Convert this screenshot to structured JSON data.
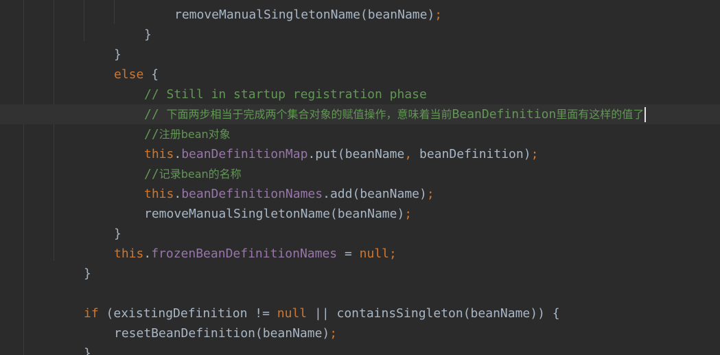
{
  "editor": {
    "lines": [
      {
        "indent": 5,
        "tokens": [
          {
            "t": "removeManualSingletonName(beanName)",
            "c": "plain"
          },
          {
            "t": ";",
            "c": "kw"
          }
        ]
      },
      {
        "indent": 4,
        "tokens": [
          {
            "t": "}",
            "c": "plain"
          }
        ]
      },
      {
        "indent": 3,
        "tokens": [
          {
            "t": "}",
            "c": "plain"
          }
        ]
      },
      {
        "indent": 3,
        "tokens": [
          {
            "t": "else",
            "c": "kw"
          },
          {
            "t": " {",
            "c": "plain"
          }
        ]
      },
      {
        "indent": 4,
        "tokens": [
          {
            "t": "// Still in startup registration phase",
            "c": "comment"
          }
        ]
      },
      {
        "indent": 4,
        "current": true,
        "tokens": [
          {
            "t": "// ",
            "c": "comment"
          },
          {
            "t": "下面两步相当于完成两个集合对象的赋值操作，意味着当前",
            "c": "comment cjk"
          },
          {
            "t": "BeanDefinition",
            "c": "comment"
          },
          {
            "t": "里面有这样的值了",
            "c": "comment cjk"
          }
        ]
      },
      {
        "indent": 4,
        "tokens": [
          {
            "t": "//",
            "c": "comment"
          },
          {
            "t": "注册bean对象",
            "c": "comment cjk"
          }
        ]
      },
      {
        "indent": 4,
        "tokens": [
          {
            "t": "this",
            "c": "kw"
          },
          {
            "t": ".",
            "c": "plain"
          },
          {
            "t": "beanDefinitionMap",
            "c": "field"
          },
          {
            "t": ".put(beanName",
            "c": "plain"
          },
          {
            "t": ",",
            "c": "kw"
          },
          {
            "t": " beanDefinition)",
            "c": "plain"
          },
          {
            "t": ";",
            "c": "kw"
          }
        ]
      },
      {
        "indent": 4,
        "tokens": [
          {
            "t": "//",
            "c": "comment"
          },
          {
            "t": "记录bean的名称",
            "c": "comment cjk"
          }
        ]
      },
      {
        "indent": 4,
        "tokens": [
          {
            "t": "this",
            "c": "kw"
          },
          {
            "t": ".",
            "c": "plain"
          },
          {
            "t": "beanDefinitionNames",
            "c": "field"
          },
          {
            "t": ".add(beanName)",
            "c": "plain"
          },
          {
            "t": ";",
            "c": "kw"
          }
        ]
      },
      {
        "indent": 4,
        "tokens": [
          {
            "t": "removeManualSingletonName(beanName)",
            "c": "plain"
          },
          {
            "t": ";",
            "c": "kw"
          }
        ]
      },
      {
        "indent": 3,
        "tokens": [
          {
            "t": "}",
            "c": "plain"
          }
        ]
      },
      {
        "indent": 3,
        "tokens": [
          {
            "t": "this",
            "c": "kw"
          },
          {
            "t": ".",
            "c": "plain"
          },
          {
            "t": "frozenBeanDefinitionNames",
            "c": "field"
          },
          {
            "t": " = ",
            "c": "plain"
          },
          {
            "t": "null",
            "c": "kw"
          },
          {
            "t": ";",
            "c": "kw"
          }
        ]
      },
      {
        "indent": 2,
        "tokens": [
          {
            "t": "}",
            "c": "plain"
          }
        ]
      },
      {
        "indent": 0,
        "tokens": []
      },
      {
        "indent": 2,
        "tokens": [
          {
            "t": "if",
            "c": "kw"
          },
          {
            "t": " (existingDefinition != ",
            "c": "plain"
          },
          {
            "t": "null",
            "c": "kw"
          },
          {
            "t": " || containsSingleton(beanName)) {",
            "c": "plain"
          }
        ]
      },
      {
        "indent": 3,
        "tokens": [
          {
            "t": "resetBeanDefinition(beanName)",
            "c": "plain"
          },
          {
            "t": ";",
            "c": "kw"
          }
        ]
      },
      {
        "indent": 2,
        "tokens": [
          {
            "t": "}",
            "c": "plain"
          }
        ]
      }
    ]
  }
}
